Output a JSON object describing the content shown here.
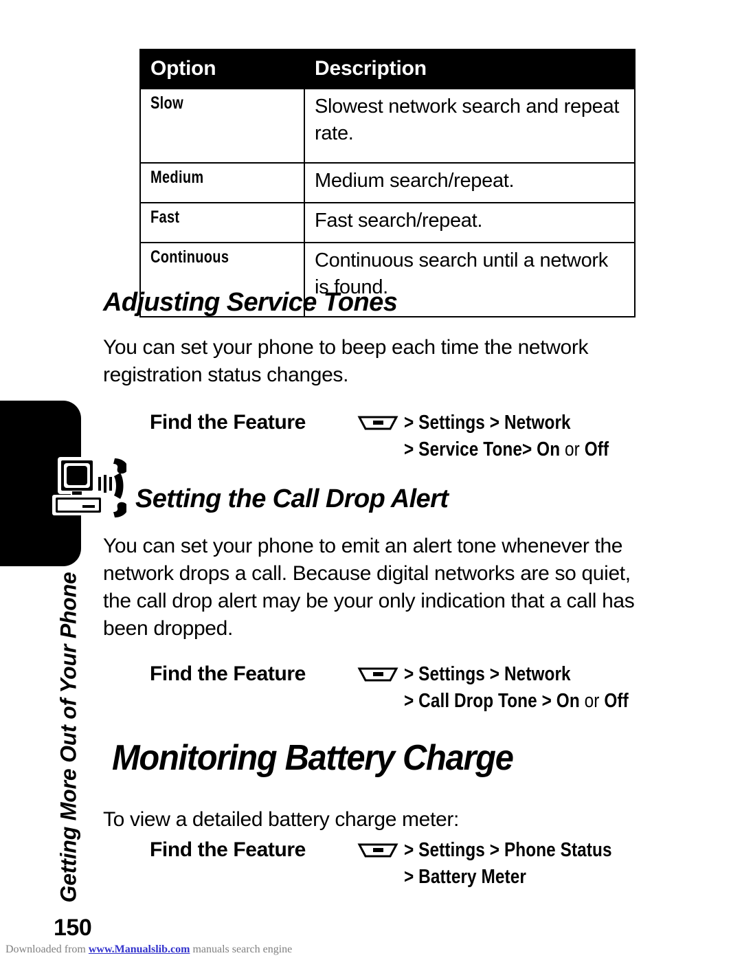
{
  "table": {
    "headers": [
      "Option",
      "Description"
    ],
    "rows": [
      {
        "option": "Slow",
        "description": "Slowest network search and repeat rate."
      },
      {
        "option": "Medium",
        "description": "Medium search/repeat."
      },
      {
        "option": "Fast",
        "description": "Fast search/repeat."
      },
      {
        "option": "Continuous",
        "description": "Continuous search until a network is found."
      }
    ]
  },
  "chapter": {
    "title": "Getting More Out of Your Phone",
    "icon": "computer-phone-icon"
  },
  "sections": [
    {
      "heading": "Adjusting Service Tones",
      "body": "You can set your phone to beep each time the network registration status changes.",
      "find_the_feature": {
        "label": "Find the Feature",
        "icon": "menu-key-icon",
        "line1": "> Settings > Network",
        "line2_prefix": "> Service Tone> ",
        "line2_on": "On",
        "line2_or": " or ",
        "line2_off": "Off"
      }
    },
    {
      "heading": "Setting the Call Drop Alert",
      "body": "You can set your phone to emit an alert tone whenever the network drops a call. Because digital networks are so quiet, the call drop alert may be your only indication that a call has been dropped.",
      "find_the_feature": {
        "label": "Find the Feature",
        "icon": "menu-key-icon",
        "line1": "> Settings > Network",
        "line2_prefix": "> Call Drop Tone > ",
        "line2_on": "On",
        "line2_or": " or ",
        "line2_off": "Off"
      }
    },
    {
      "heading": "Monitoring Battery Charge",
      "body": "To view a detailed battery charge meter:",
      "find_the_feature": {
        "label": "Find the Feature",
        "icon": "menu-key-icon",
        "line1": "> Settings > Phone Status",
        "line2_prefix": "> Battery Meter",
        "line2_on": "",
        "line2_or": "",
        "line2_off": ""
      }
    }
  ],
  "page_number": "150",
  "footer": {
    "prefix": "Downloaded from ",
    "link": "www.Manualslib.com",
    "suffix": " manuals search engine"
  },
  "colors": {
    "ink": "#000000",
    "paper": "#ffffff",
    "link": "#3333cc",
    "footer_text": "#808080"
  }
}
